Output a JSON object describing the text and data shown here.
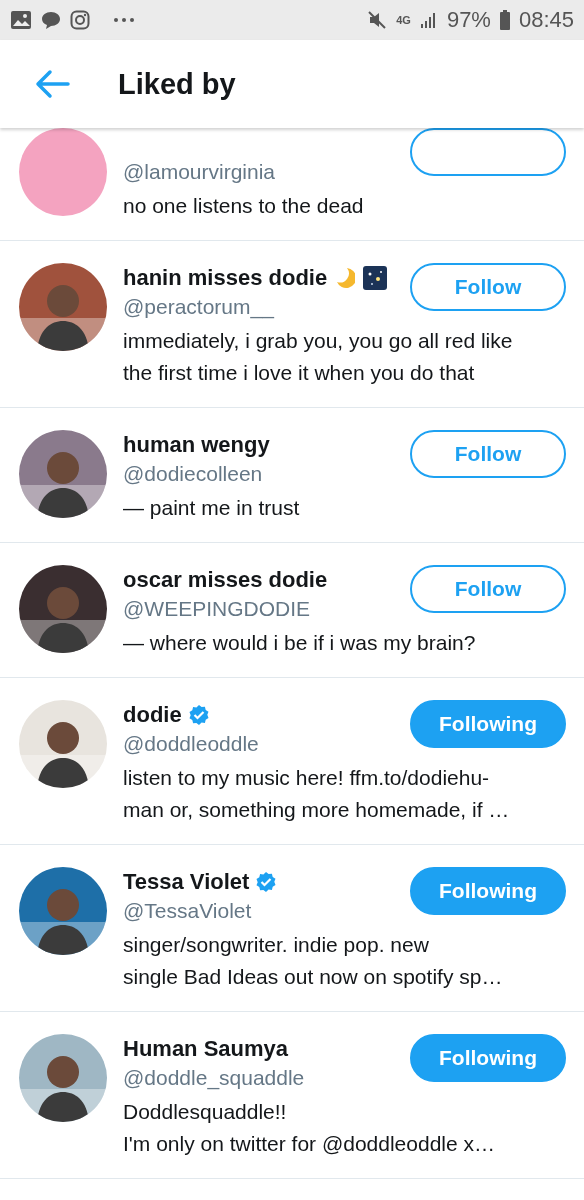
{
  "status_bar": {
    "network": "4G",
    "battery": "97%",
    "time": "08:45"
  },
  "header": {
    "title": "Liked by"
  },
  "users": [
    {
      "handle": "@lamourvirginia",
      "bio_lines": [
        "no one listens to the dead"
      ],
      "following": false
    },
    {
      "name": "hanin misses dodie",
      "name_icons": [
        {
          "kind": "moon"
        },
        {
          "kind": "night"
        }
      ],
      "handle": "@peractorum__",
      "bio_lines": [
        "immediately, i grab you, you go all red like",
        "the first time i love it when you do that"
      ],
      "button": "Follow",
      "following": false,
      "verified": false
    },
    {
      "name": "human wengy",
      "handle": "@dodiecolleen",
      "bio_lines": [
        "— paint me in trust"
      ],
      "button": "Follow",
      "following": false,
      "verified": false
    },
    {
      "name": "oscar misses dodie",
      "handle": "@WEEPINGDODIE",
      "bio_lines": [
        "— where would i be if i was my brain?"
      ],
      "button": "Follow",
      "following": false,
      "verified": false
    },
    {
      "name": "dodie",
      "handle": "@doddleoddle",
      "bio_lines": [
        "listen to my music here! ffm.to/dodiehu-",
        "man or, something more homemade, if …"
      ],
      "button": "Following",
      "following": true,
      "verified": true
    },
    {
      "name": "Tessa Violet",
      "handle": "@TessaViolet",
      "bio_lines": [
        "singer/songwriter. indie pop. new",
        "single Bad Ideas out now on spotify sp…"
      ],
      "button": "Following",
      "following": true,
      "verified": true
    },
    {
      "name": "Human Saumya",
      "handle": "@doddle_squaddle",
      "bio_lines": [
        "Doddlesquaddle!!",
        "I'm only on twitter for @doddleoddle x…"
      ],
      "button": "Following",
      "following": true,
      "verified": false
    }
  ]
}
